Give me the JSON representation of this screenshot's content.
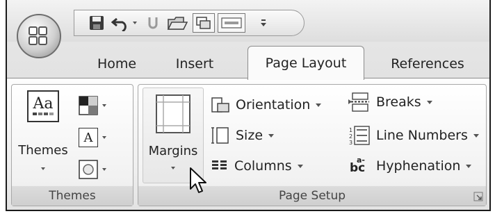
{
  "tabs": [
    {
      "label": "Home",
      "active": false
    },
    {
      "label": "Insert",
      "active": false
    },
    {
      "label": "Page Layout",
      "active": true
    },
    {
      "label": "References",
      "active": false
    }
  ],
  "quick_access": {
    "items": [
      "save-icon",
      "undo-icon",
      "redo-icon",
      "open-folder-icon",
      "print-preview-icon",
      "spelling-icon",
      "customize-icon"
    ]
  },
  "themes_group": {
    "label": "Themes",
    "themes_button": "Themes",
    "themes_icon_text": "Aa",
    "fonts_icon_text": "A"
  },
  "page_setup_group": {
    "label": "Page Setup",
    "margins_button": "Margins",
    "orientation": "Orientation",
    "size": "Size",
    "columns": "Columns",
    "breaks": "Breaks",
    "line_numbers": "Line Numbers",
    "hyphenation": "Hyphenation",
    "hyphenation_icon_text": "bc",
    "hyphenation_icon_sup": "a-"
  }
}
